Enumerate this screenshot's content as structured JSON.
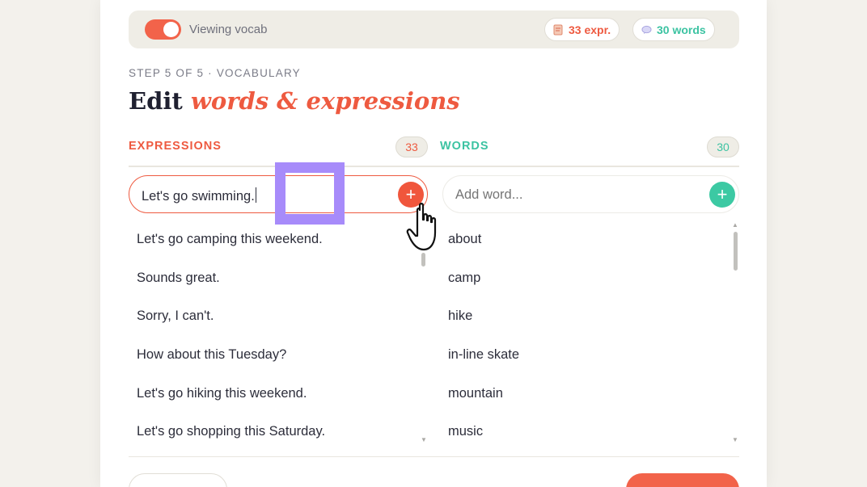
{
  "topbar": {
    "toggle_label": "Viewing vocab",
    "toggle_on": true,
    "expr_pill": "33 expr.",
    "words_pill": "30 words"
  },
  "header": {
    "step": "STEP 5 OF 5 · VOCABULARY",
    "title_plain": "Edit ",
    "title_accent": "words & expressions"
  },
  "expressions": {
    "heading": "EXPRESSIONS",
    "count": "33",
    "input_value": "Let's go swimming.",
    "add_label": "+",
    "items": [
      "Let's go camping this weekend.",
      "Sounds great.",
      "Sorry, I can't.",
      "How about this Tuesday?",
      "Let's go hiking this weekend.",
      "Let's go shopping this Saturday."
    ]
  },
  "words": {
    "heading": "WORDS",
    "count": "30",
    "input_placeholder": "Add word...",
    "add_label": "+",
    "items": [
      "about",
      "camp",
      "hike",
      "in-line skate",
      "mountain",
      "music"
    ]
  },
  "colors": {
    "accent_coral": "#ee5a40",
    "accent_teal": "#3cc3a2",
    "highlight_purple": "#a78bfa"
  },
  "icons": {
    "expr_pill_icon": "document-icon",
    "words_pill_icon": "speech-bubble-icon",
    "cursor": "hand-pointer-icon"
  }
}
